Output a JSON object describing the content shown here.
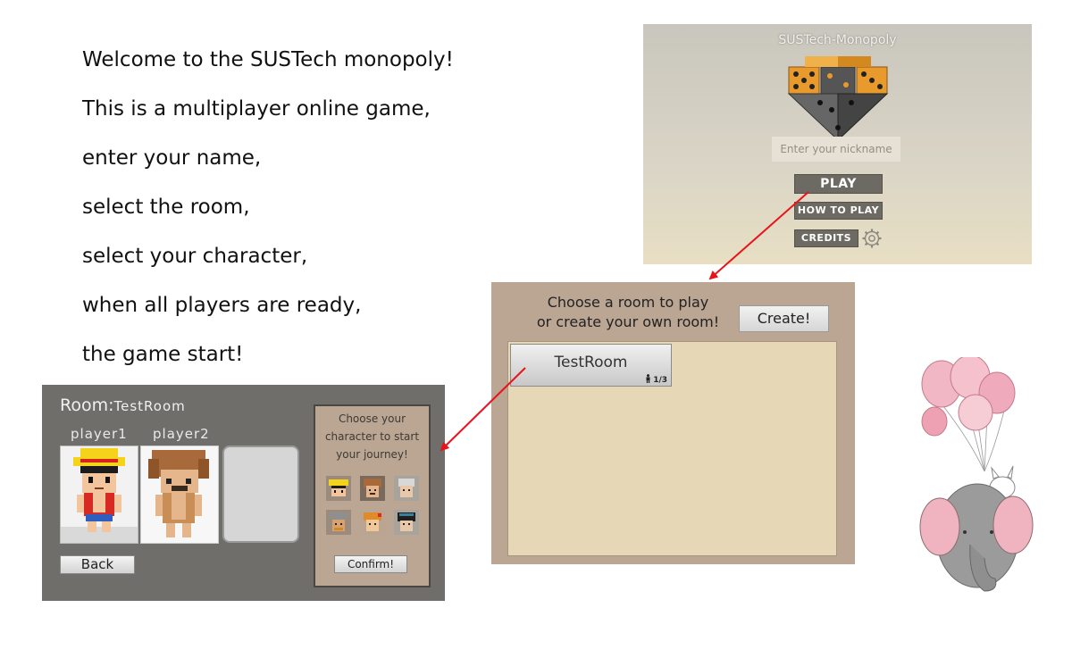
{
  "intro": {
    "lines": [
      "Welcome to the SUSTech monopoly!",
      "This is a multiplayer online game,",
      "enter your name,",
      "select the room,",
      "select your character,",
      "when all players are ready,",
      "the game start!"
    ]
  },
  "title_screen": {
    "game_title": "SUSTech-Monopoly",
    "nickname_placeholder": "Enter your nickname",
    "play_label": "PLAY",
    "how_to_play_label": "HOW TO PLAY",
    "credits_label": "CREDITS",
    "settings_icon": "gear-icon"
  },
  "room_select": {
    "prompt_line1": "Choose a room to play",
    "prompt_line2": "or create your own room!",
    "create_label": "Create!",
    "rooms": [
      {
        "name": "TestRoom",
        "players": "1/3"
      }
    ]
  },
  "lobby": {
    "room_key": "Room:",
    "room_name": "TestRoom",
    "players": [
      "player1",
      "player2"
    ],
    "back_label": "Back",
    "char_prompt_line1": "Choose your",
    "char_prompt_line2": "character to start",
    "char_prompt_line3": "your journey!",
    "confirm_label": "Confirm!",
    "character_count": 6
  },
  "colors": {
    "arrow": "#e8141a",
    "panel_tan": "#bba593",
    "lobby_gray": "#6f6e6b",
    "dice_orange": "#e89a2c"
  }
}
